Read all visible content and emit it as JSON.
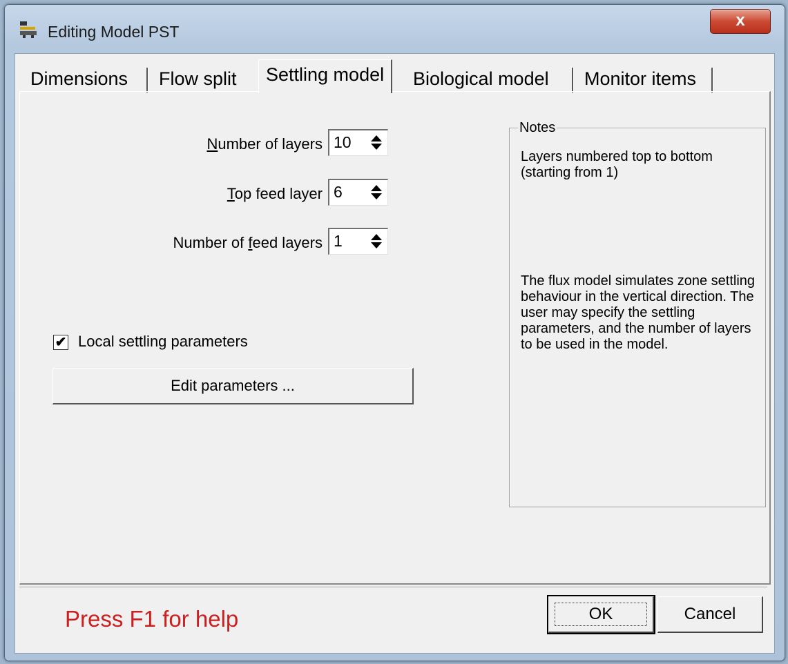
{
  "window": {
    "title": "Editing Model PST",
    "close_label": "x"
  },
  "tabs": [
    {
      "label": "Dimensions"
    },
    {
      "label": "Flow split"
    },
    {
      "label": "Settling model"
    },
    {
      "label": "Biological model"
    },
    {
      "label": "Monitor items"
    }
  ],
  "active_tab": "Settling model",
  "fields": {
    "num_layers": {
      "label_pre": "",
      "label_mn": "N",
      "label_post": "umber of layers",
      "value": "10"
    },
    "top_feed": {
      "label_pre": "",
      "label_mn": "T",
      "label_post": "op feed layer",
      "value": "6"
    },
    "num_feed": {
      "label_pre": "Number of ",
      "label_mn": "f",
      "label_post": "eed layers",
      "value": "1"
    }
  },
  "local_settling": {
    "label": "Local settling parameters",
    "checked": true,
    "mark": "✔"
  },
  "edit_button": {
    "label": "Edit parameters ..."
  },
  "notes": {
    "legend": "Notes",
    "text1": "Layers numbered top to bottom (starting from 1)",
    "text2": "The flux model simulates zone settling behaviour in the vertical direction.  The user may specify the settling parameters, and the number of layers to be used in the model."
  },
  "footer": {
    "help": "Press F1 for help",
    "ok": "OK",
    "cancel": "Cancel"
  }
}
